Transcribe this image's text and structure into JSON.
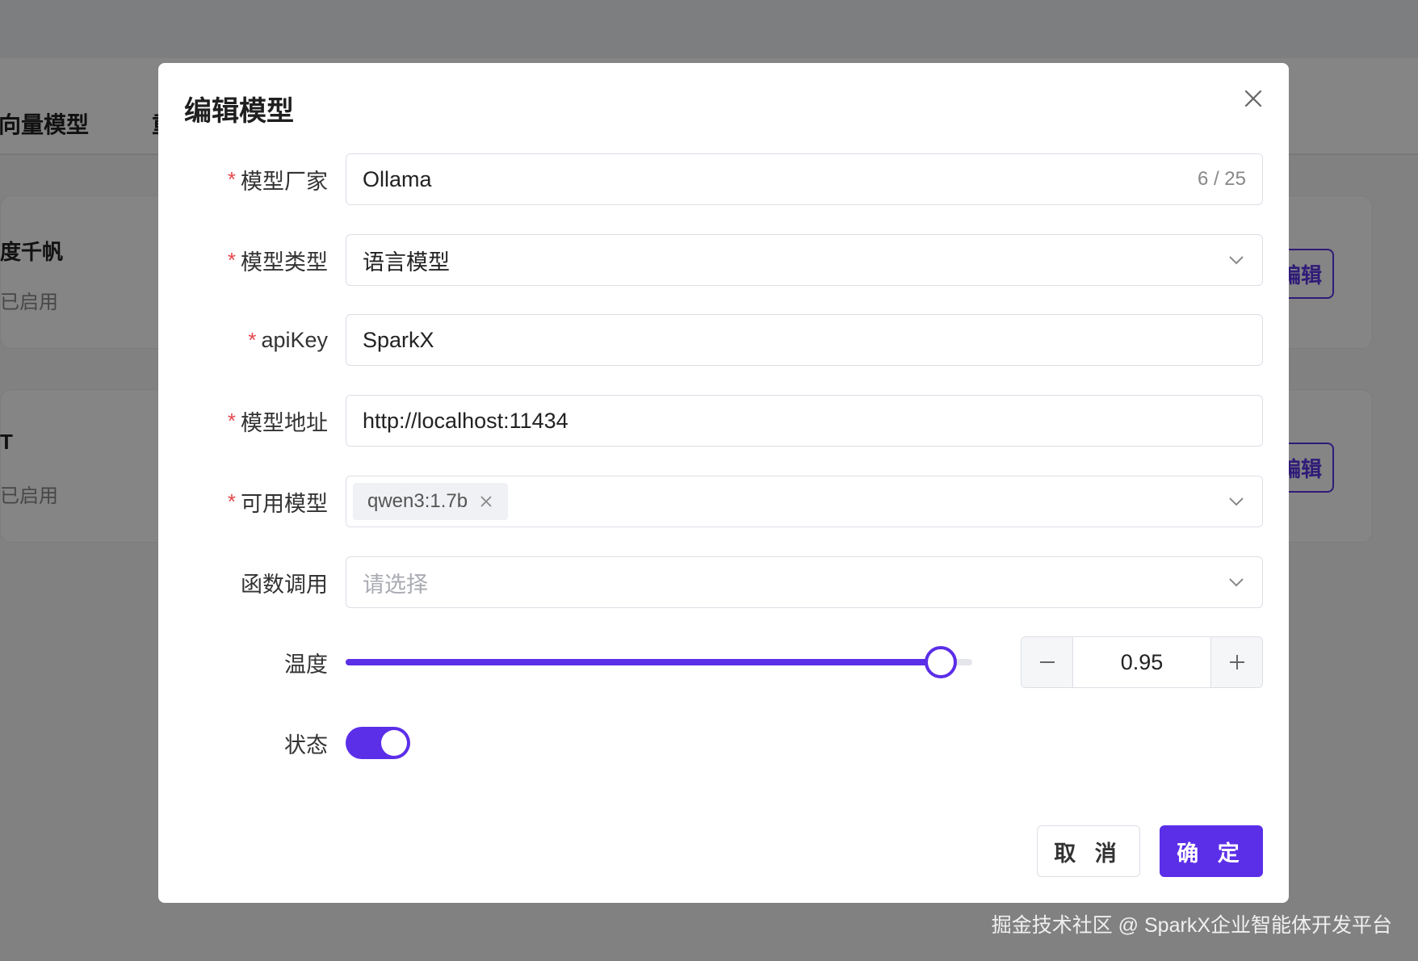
{
  "background": {
    "tabs": [
      "向量模型",
      "重"
    ],
    "cards": [
      {
        "title": "度千帆",
        "status": "已启用",
        "action": "编辑"
      },
      {
        "title": "T",
        "status": "已启用",
        "action": "编辑"
      }
    ]
  },
  "dialog": {
    "title": "编辑模型",
    "fields": {
      "vendor": {
        "label": "模型厂家",
        "required": true,
        "value": "Ollama",
        "count": "6 / 25"
      },
      "type": {
        "label": "模型类型",
        "required": true,
        "value": "语言模型"
      },
      "apikey": {
        "label": "apiKey",
        "required": true,
        "value": "SparkX"
      },
      "address": {
        "label": "模型地址",
        "required": true,
        "value": "http://localhost:11434"
      },
      "models": {
        "label": "可用模型",
        "required": true,
        "tags": [
          "qwen3:1.7b"
        ]
      },
      "function_call": {
        "label": "函数调用",
        "required": false,
        "placeholder": "请选择"
      },
      "temperature": {
        "label": "温度",
        "value": "0.95",
        "slider_fraction": 0.95
      },
      "status": {
        "label": "状态",
        "on": true
      }
    },
    "buttons": {
      "cancel": "取 消",
      "ok": "确 定"
    }
  },
  "required_mark": "*",
  "watermark": "掘金技术社区 @ SparkX企业智能体开发平台",
  "colors": {
    "accent": "#5b2ee8",
    "required": "#e5484d"
  }
}
